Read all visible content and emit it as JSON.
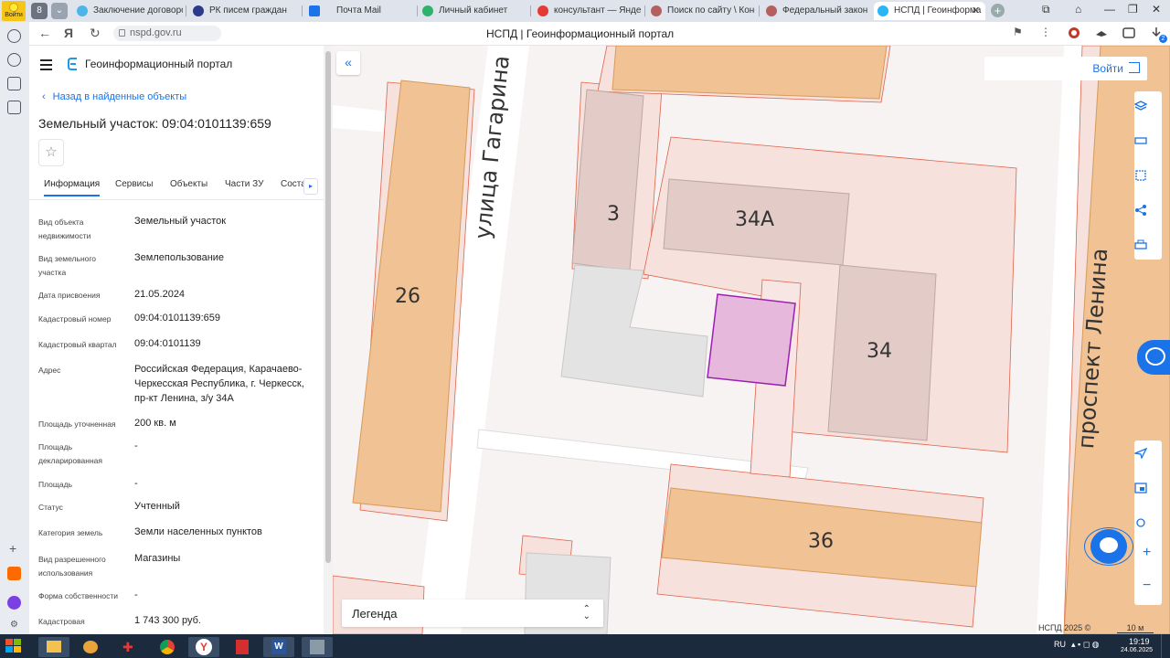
{
  "browser": {
    "yandex_button_label": "Войти",
    "tabs": [
      {
        "title": "Заключение договоров",
        "active": false
      },
      {
        "title": "РК писем граждан",
        "active": false
      },
      {
        "title": "Почта Mail",
        "active": false
      },
      {
        "title": "Личный кабинет",
        "active": false
      },
      {
        "title": "консультант — Яндекс",
        "active": false
      },
      {
        "title": "Поиск по сайту \\ Консу",
        "active": false
      },
      {
        "title": "Федеральный закон \"О",
        "active": false
      },
      {
        "title": "НСПД | Геоинформа",
        "active": true
      }
    ],
    "address": "nspd.gov.ru",
    "page_title": "НСПД | Геоинформационный портал",
    "badge_count": "2"
  },
  "panel": {
    "portal_title": "Геоинформационный портал",
    "back_link": "Назад в найденные объекты",
    "parcel_title": "Земельный участок: 09:04:0101139:659",
    "tabs": [
      "Информация",
      "Сервисы",
      "Объекты",
      "Части ЗУ",
      "Соста"
    ],
    "fields": [
      {
        "label": "Вид объекта недвижимости",
        "value": "Земельный участок"
      },
      {
        "label": "Вид земельного участка",
        "value": "Землепользование"
      },
      {
        "label": "Дата присвоения",
        "value": "21.05.2024"
      },
      {
        "label": "Кадастровый номер",
        "value": "09:04:0101139:659"
      },
      {
        "label": "Кадастровый квартал",
        "value": "09:04:0101139"
      },
      {
        "label": "Адрес",
        "value": "Российская Федерация, Карачаево-Черкесская Республика, г. Черкесск, пр-кт Ленина, з/у 34А"
      },
      {
        "label": "Площадь уточненная",
        "value": "200 кв. м"
      },
      {
        "label": "Площадь декларированная",
        "value": "-"
      },
      {
        "label": "Площадь",
        "value": "-"
      },
      {
        "label": "Статус",
        "value": "Учтенный"
      },
      {
        "label": "Категория земель",
        "value": "Земли населенных пунктов"
      },
      {
        "label": "Вид разрешенного использования",
        "value": "Магазины"
      },
      {
        "label": "Форма собственности",
        "value": "-"
      },
      {
        "label": "Кадастровая",
        "value": "1 743 300 руб."
      }
    ]
  },
  "map": {
    "login_label": "Войти",
    "street_gagarina": "улица Гагарина",
    "street_lenina": "проспект Ленина",
    "buildings": {
      "b26": "26",
      "b3": "3",
      "b34a": "34А",
      "b34": "34",
      "b36": "36"
    },
    "legend_label": "Легенда",
    "copyright": "НСПД 2025 ©",
    "scale": "10 м",
    "colors": {
      "building": "#f0c294",
      "parcel_line": "#e0624a",
      "selected_parcel": "#e6b8dc",
      "selected_border": "#9b1fb5",
      "accent": "#1a73e8"
    }
  },
  "taskbar": {
    "lang": "RU",
    "time": "19:19",
    "date": "24.06.2025"
  }
}
